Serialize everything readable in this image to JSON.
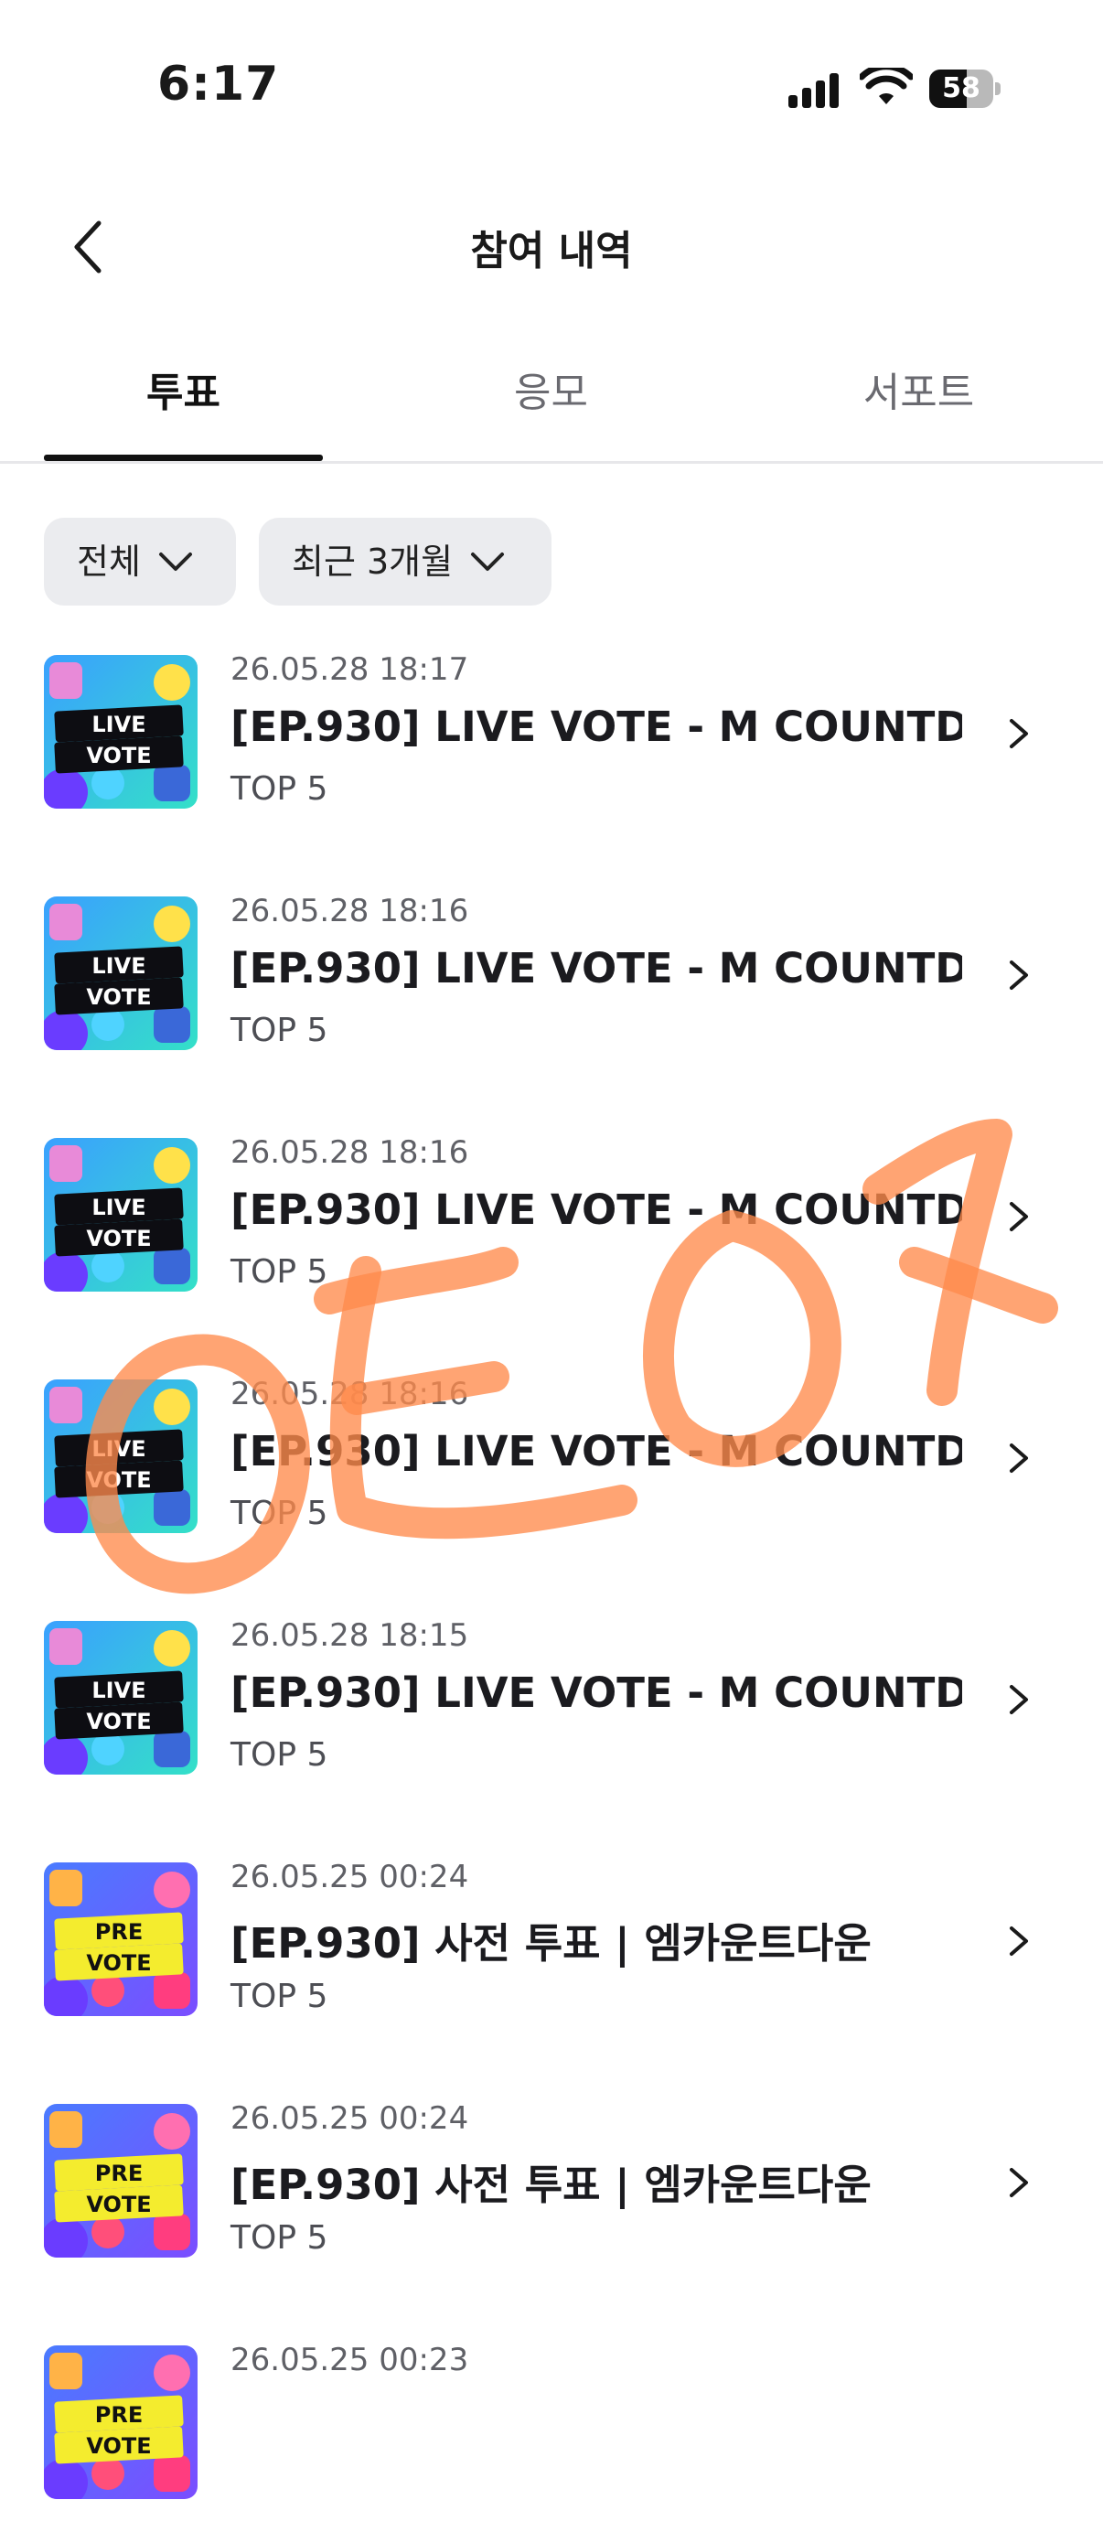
{
  "status_bar": {
    "time": "6:17",
    "battery_percent": "58",
    "battery_level": 0.58,
    "icons": [
      "signal-icon",
      "wifi-icon",
      "battery-icon"
    ]
  },
  "header": {
    "title": "참여 내역",
    "back_icon": "chevron-left-icon"
  },
  "tabs": [
    {
      "label": "투표",
      "active": true
    },
    {
      "label": "응모",
      "active": false
    },
    {
      "label": "서포트",
      "active": false
    }
  ],
  "filters": [
    {
      "label": "전체",
      "icon": "chevron-down-icon"
    },
    {
      "label": "최근 3개월",
      "icon": "chevron-down-icon"
    }
  ],
  "items": [
    {
      "date": "26.05.28 18:17",
      "title": "[EP.930] LIVE VOTE - M COUNTD...",
      "subtitle": "TOP 5",
      "thumb_line1": "LIVE",
      "thumb_line2": "VOTE"
    },
    {
      "date": "26.05.28 18:16",
      "title": "[EP.930] LIVE VOTE - M COUNTD...",
      "subtitle": "TOP 5",
      "thumb_line1": "LIVE",
      "thumb_line2": "VOTE"
    },
    {
      "date": "26.05.28 18:16",
      "title": "[EP.930] LIVE VOTE - M COUNTD...",
      "subtitle": "TOP 5",
      "thumb_line1": "LIVE",
      "thumb_line2": "VOTE"
    },
    {
      "date": "26.05.28 18:16",
      "title": "[EP.930] LIVE VOTE - M COUNTD...",
      "subtitle": "TOP 5",
      "thumb_line1": "LIVE",
      "thumb_line2": "VOTE"
    },
    {
      "date": "26.05.28 18:15",
      "title": "[EP.930] LIVE VOTE - M COUNTD...",
      "subtitle": "TOP 5",
      "thumb_line1": "LIVE",
      "thumb_line2": "VOTE"
    },
    {
      "date": "26.05.25 00:24",
      "title": "[EP.930] 사전 투표 | 엠카운트다운",
      "subtitle": "TOP 5",
      "thumb_line1": "PRE",
      "thumb_line2": "VOTE"
    },
    {
      "date": "26.05.25 00:24",
      "title": "[EP.930] 사전 투표 | 엠카운트다운",
      "subtitle": "TOP 5",
      "thumb_line1": "PRE",
      "thumb_line2": "VOTE"
    },
    {
      "date": "26.05.25 00:23",
      "title": "",
      "subtitle": "",
      "thumb_line1": "PRE",
      "thumb_line2": "VOTE"
    }
  ],
  "colors": {
    "live_bg_top": "#3aa0ff",
    "live_bg_bottom": "#34e0c8",
    "pre_bg_top": "#4a7bff",
    "pre_bg_bottom": "#7b4dff",
    "pre_label_bg": "#f4ec2e",
    "label_bg": "#0d0d12",
    "scribble": "#ff8a4c"
  }
}
